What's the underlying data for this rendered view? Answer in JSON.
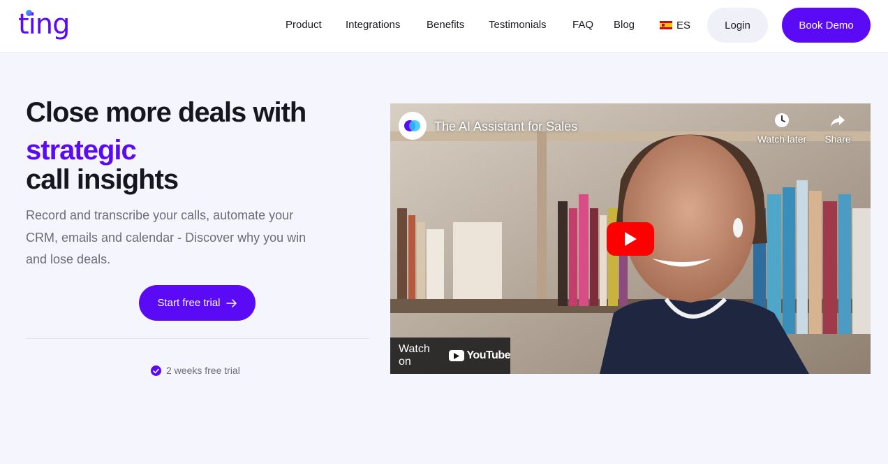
{
  "header": {
    "logo": "ting",
    "nav": [
      "Product",
      "Integrations",
      "Benefits",
      "Testimonials",
      "FAQ",
      "Blog"
    ],
    "language": "ES",
    "login_label": "Login",
    "demo_label": "Book Demo"
  },
  "hero": {
    "headline_1": "Close more deals with",
    "headline_accent": "strategic",
    "headline_2": "call insights",
    "subtitle": "Record and transcribe your calls, automate your CRM, emails and calendar - Discover why you win and lose deals.",
    "cta_label": "Start free trial",
    "trial_note": "2 weeks free trial"
  },
  "video": {
    "title": "The AI Assistant for Sales",
    "watch_later": "Watch later",
    "share": "Share",
    "watch_on": "Watch on",
    "platform": "YouTube"
  },
  "colors": {
    "brand": "#5b0af5",
    "background": "#f5f5fd",
    "youtube_red": "#ff0000"
  },
  "icons": [
    "arrow-right-icon",
    "check-circle-icon",
    "clock-icon",
    "share-icon",
    "play-icon",
    "youtube-logo-icon",
    "flag-es-icon"
  ]
}
